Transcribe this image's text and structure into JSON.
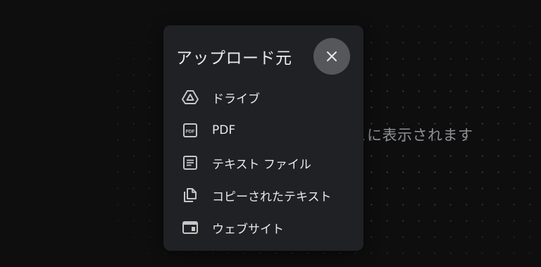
{
  "background": {
    "hint_text": "ここに表示されます"
  },
  "upload_menu": {
    "title": "アップロード元",
    "close_icon": "close-icon",
    "items": [
      {
        "label": "ドライブ",
        "icon": "drive-icon"
      },
      {
        "label": "PDF",
        "icon": "pdf-icon"
      },
      {
        "label": "テキスト ファイル",
        "icon": "text-file-icon"
      },
      {
        "label": "コピーされたテキスト",
        "icon": "copy-icon"
      },
      {
        "label": "ウェブサイト",
        "icon": "website-icon"
      }
    ]
  },
  "colors": {
    "page_background": "#0e0e0f",
    "menu_background": "#202124",
    "close_button_background": "#56575b",
    "text_primary": "#e8eaed",
    "text_muted": "#8e9094",
    "icon_color": "#c4c7c5"
  }
}
